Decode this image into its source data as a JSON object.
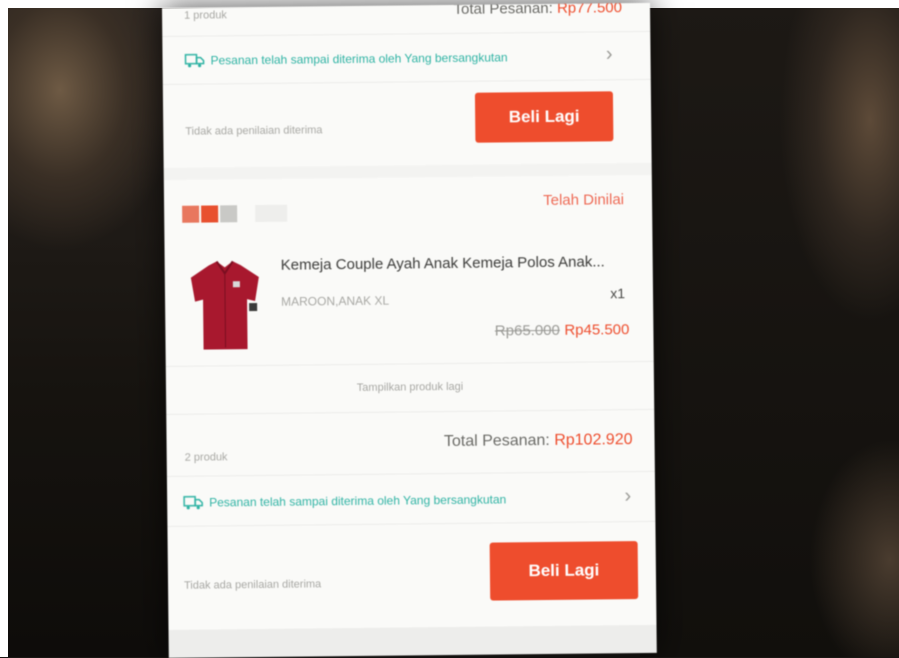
{
  "order_prev": {
    "product_count": "1 produk",
    "total_label": "Total Pesanan:",
    "total_value": "Rp77.500",
    "delivery_status": "Pesanan telah sampai diterima oleh Yang bersangkutan",
    "review_status": "Tidak ada penilaian diterima",
    "buy_again_label": "Beli Lagi"
  },
  "order_current": {
    "order_status": "Telah Dinilai",
    "product": {
      "name": "Kemeja Couple Ayah Anak Kemeja Polos Anak...",
      "variant": "MAROON,ANAK XL",
      "quantity": "x1",
      "price_original": "Rp65.000",
      "price_discount": "Rp45.500"
    },
    "show_more_label": "Tampilkan produk lagi",
    "product_count": "2 produk",
    "total_label": "Total Pesanan:",
    "total_value": "Rp102.920",
    "delivery_status": "Pesanan telah sampai diterima oleh Yang bersangkutan",
    "review_status": "Tidak ada penilaian diterima",
    "buy_again_label": "Beli Lagi"
  },
  "colors": {
    "accent": "#ee4d2d",
    "delivery_teal": "#2fb3a4",
    "shirt_maroon": "#a8182e"
  },
  "icons": [
    "truck-icon",
    "chevron-right-icon",
    "shop-logo-icon"
  ]
}
